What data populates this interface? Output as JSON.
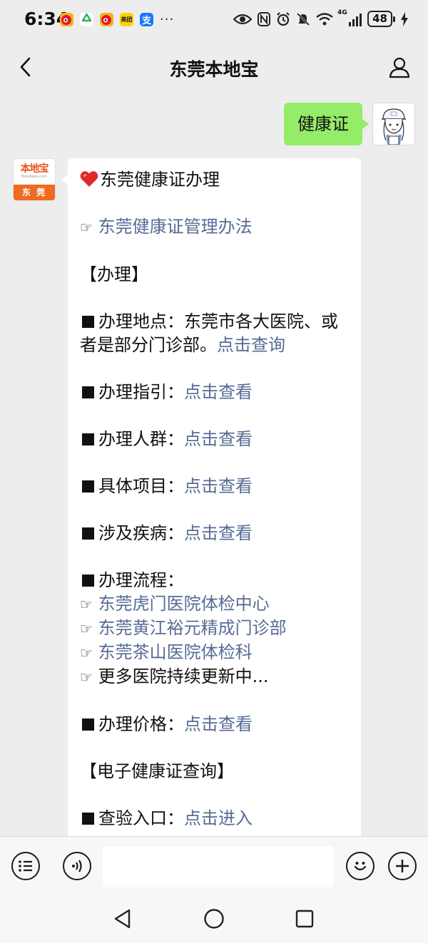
{
  "status_bar": {
    "time": "6:34",
    "left_icons": [
      "weibo-icon",
      "recycle-icon",
      "weibo-icon",
      "meituan-icon",
      "alipay-icon"
    ],
    "meituan_label": "美团",
    "alipay_label": "支",
    "more": "···",
    "right_icons": [
      "eye-icon",
      "nfc-icon",
      "alarm-icon",
      "mute-icon",
      "wifi-icon",
      "signal-4g-icon",
      "battery-icon",
      "charging-icon"
    ],
    "network_label": "4G",
    "battery_level": "48"
  },
  "header": {
    "title": "东莞本地宝",
    "back_icon": "back-chevron-icon",
    "profile_icon": "profile-icon"
  },
  "messages": {
    "outgoing": {
      "text": "健康证"
    },
    "incoming": {
      "sender_logo": {
        "name": "本地宝",
        "url": "Bendibao.com",
        "city": "东 莞"
      },
      "title": "东莞健康证办理",
      "hand": "☞",
      "lines": {
        "policy_link": "东莞健康证管理办法",
        "section_handle": "【办理】",
        "location_label": "办理地点：东莞市各大医院、或者是部分门诊部。",
        "location_link": "点击查询",
        "guide_label": "办理指引：",
        "guide_link": "点击查看",
        "crowd_label": "办理人群：",
        "crowd_link": "点击查看",
        "items_label": "具体项目：",
        "items_link": "点击查看",
        "disease_label": "涉及疾病：",
        "disease_link": "点击查看",
        "process_label": "办理流程：",
        "hospital_1": "东莞虎门医院体检中心",
        "hospital_2": "东莞黄江裕元精成门诊部",
        "hospital_3": "东莞茶山医院体检科",
        "hospital_more": "更多医院持续更新中...",
        "price_label": "办理价格：",
        "price_link": "点击查看",
        "section_query": "【电子健康证查询】",
        "entry_label": "查验入口：",
        "entry_link": "点击进入"
      }
    }
  },
  "input_bar": {
    "menu_icon": "menu-list-icon",
    "voice_icon": "voice-icon",
    "input_value": "",
    "emoji_icon": "emoji-icon",
    "plus_icon": "plus-icon"
  },
  "system_nav": [
    "back-triangle-icon",
    "home-circle-icon",
    "recents-square-icon"
  ],
  "colors": {
    "background": "#ededed",
    "bubble_out": "#95ec69",
    "link": "#576b95",
    "brand_orange": "#ee6b1f"
  }
}
